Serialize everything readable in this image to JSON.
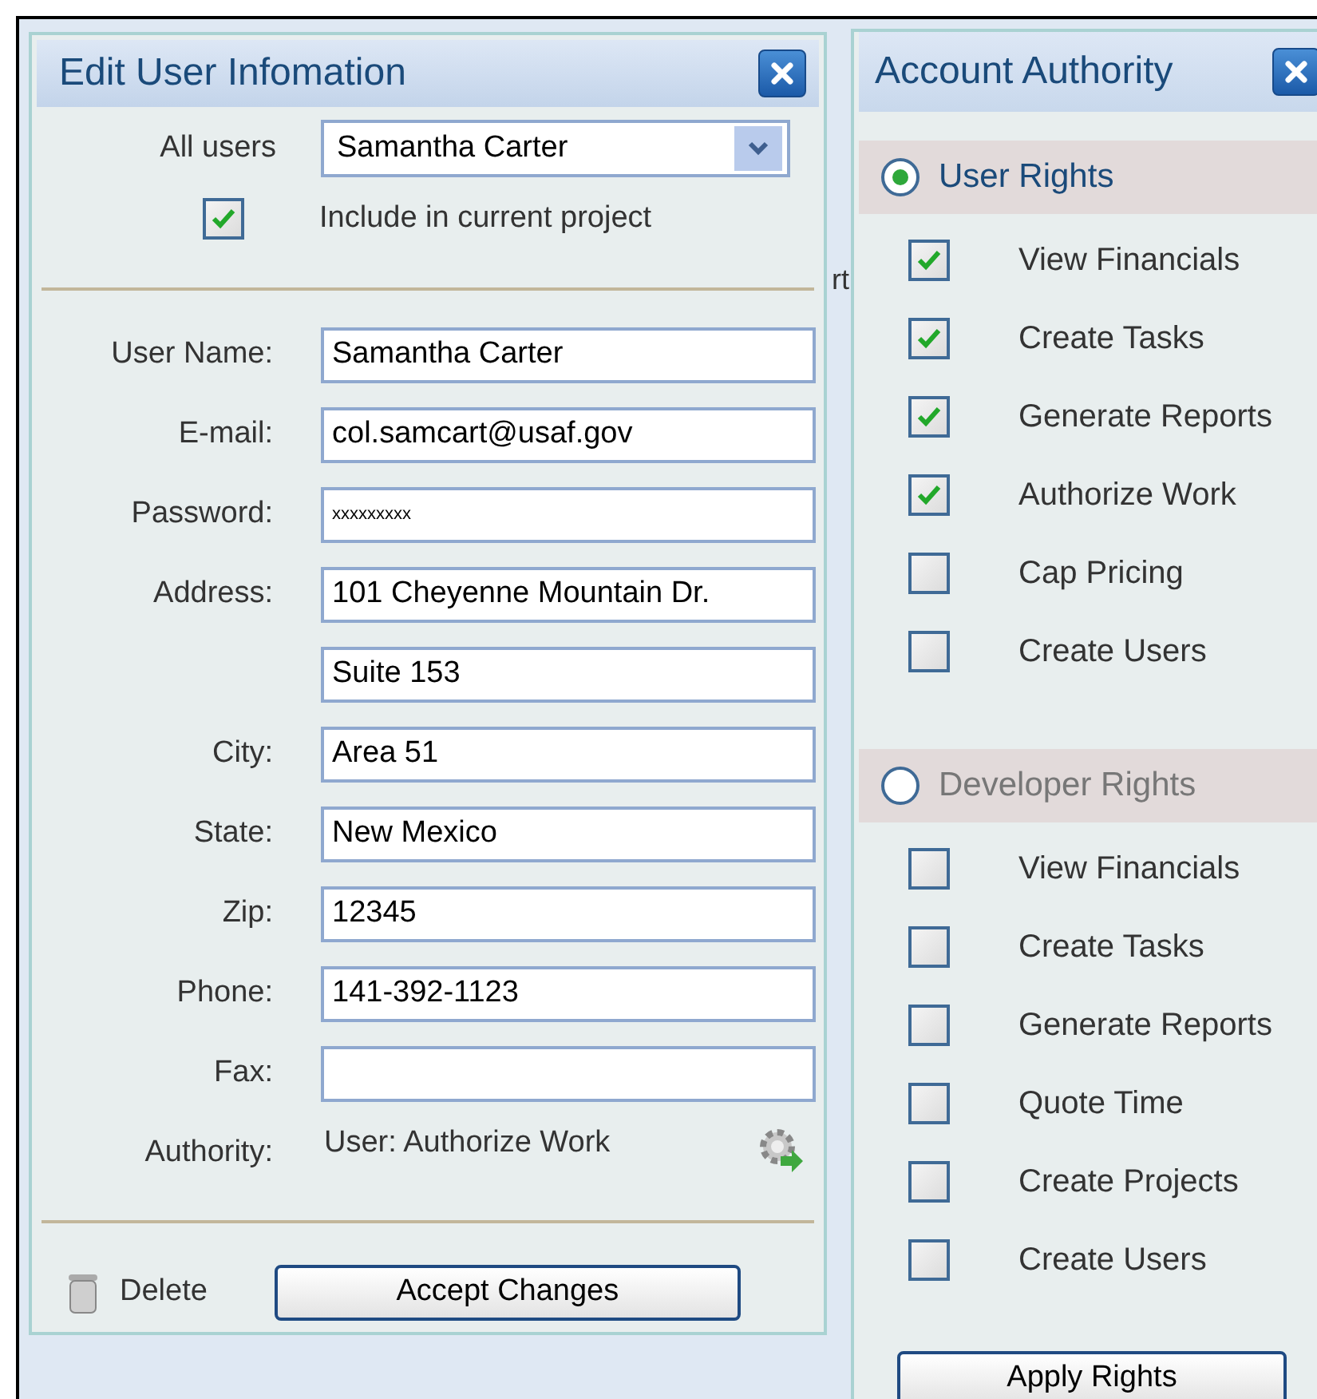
{
  "background": {
    "text_fragment": "rt"
  },
  "edit_user": {
    "title": "Edit User Infomation",
    "all_users": {
      "label": "All users",
      "value": "Samantha Carter"
    },
    "include": {
      "label": "Include in current project",
      "checked": true
    },
    "fields": [
      {
        "label": "User Name:",
        "value": "Samantha Carter"
      },
      {
        "label": "E-mail:",
        "value": "col.samcart@usaf.gov"
      },
      {
        "label": "Password:",
        "value": "xxxxxxxxx",
        "kind": "password"
      },
      {
        "label": "Address:",
        "value": "101 Cheyenne Mountain Dr."
      },
      {
        "value": "Suite 153"
      },
      {
        "label": "City:",
        "value": "Area 51"
      },
      {
        "label": "State:",
        "value": "New Mexico"
      },
      {
        "label": "Zip:",
        "value": "12345"
      },
      {
        "label": "Phone:",
        "value": "141-392-1123"
      },
      {
        "label": "Fax:"
      }
    ],
    "authority": {
      "label": "Authority:",
      "value": "User: Authorize Work"
    },
    "delete": "Delete",
    "accept": "Accept Changes"
  },
  "account_authority": {
    "title": "Account Authority",
    "groups": [
      {
        "label": "User Rights",
        "selected": true,
        "items": [
          {
            "label": "View Financials",
            "checked": true
          },
          {
            "label": "Create Tasks",
            "checked": true
          },
          {
            "label": "Generate Reports",
            "checked": true
          },
          {
            "label": "Authorize Work",
            "checked": true
          },
          {
            "label": "Cap Pricing",
            "checked": false
          },
          {
            "label": "Create Users",
            "checked": false
          }
        ]
      },
      {
        "label": "Developer Rights",
        "selected": false,
        "items": [
          {
            "label": "View Financials",
            "checked": false
          },
          {
            "label": "Create Tasks",
            "checked": false
          },
          {
            "label": "Generate Reports",
            "checked": false
          },
          {
            "label": "Quote Time",
            "checked": false
          },
          {
            "label": "Create Projects",
            "checked": false
          },
          {
            "label": "Create Users",
            "checked": false
          }
        ]
      }
    ],
    "apply": "Apply Rights"
  }
}
